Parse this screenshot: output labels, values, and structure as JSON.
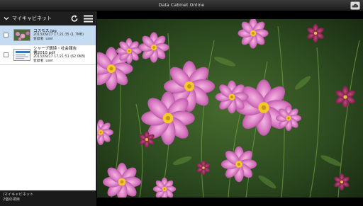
{
  "app": {
    "title": "Data Cabinet Online"
  },
  "header": {
    "folder_title": "マイキャビネット"
  },
  "icons": {
    "back": "chevron-down-icon",
    "refresh": "refresh-icon",
    "menu": "hamburger-menu-icon",
    "cloud": "cloud-sync-icon"
  },
  "files": [
    {
      "name": "コスモス.jpg",
      "date": "2013/09/17 17:21:35 (1.7MB)",
      "owner": "登録者 :user",
      "selected": true
    },
    {
      "name_line1": "シャープ環境・社会報告",
      "name_line2": "書2010.pdf",
      "date": "2013/09/17 17:21:51 (62.0KB)",
      "owner": "登録者 :user",
      "selected": false
    }
  ],
  "footer": {
    "path": "/マイキャビネット",
    "count": "2個の項目"
  },
  "colors": {
    "selected_row": "#c5dbf1",
    "header_bg": "#1f1f1f",
    "titlebar_bg": "#2a2a2a"
  }
}
